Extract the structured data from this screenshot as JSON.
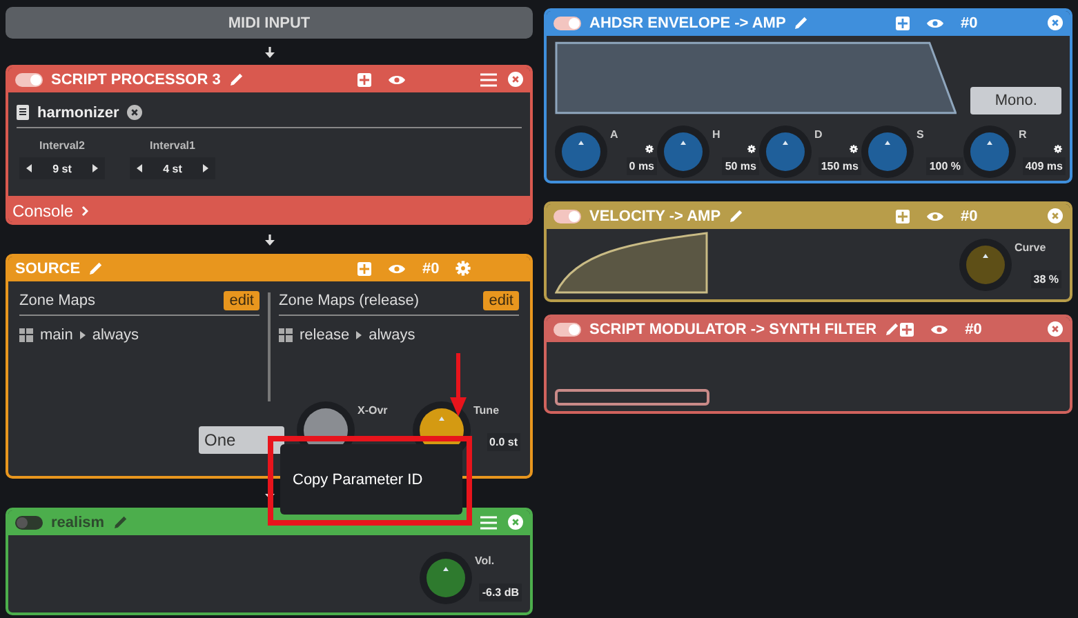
{
  "midi_input": {
    "label": "MIDI INPUT"
  },
  "left_modules": [
    {
      "kind": "script_processor",
      "title": "SCRIPT PROCESSOR 3",
      "color": "#d9594f",
      "enabled": true,
      "script": {
        "name": "harmonizer"
      },
      "params": [
        {
          "label": "Interval2",
          "value": "9 st"
        },
        {
          "label": "Interval1",
          "value": "4 st"
        }
      ],
      "footer": "Console"
    },
    {
      "kind": "source",
      "title": "SOURCE",
      "color": "#e8961e",
      "tag": "#0",
      "panels": [
        {
          "title": "Zone Maps",
          "edit": "edit",
          "zones": [
            {
              "name": "main",
              "condition": "always"
            }
          ]
        },
        {
          "title": "Zone Maps (release)",
          "edit": "edit",
          "zones": [
            {
              "name": "release",
              "condition": "always"
            }
          ]
        }
      ],
      "button": "One",
      "knobs": [
        {
          "label": "X-Ovr",
          "color": "#8a8d92"
        },
        {
          "label": "Tune",
          "value": "0.0 st",
          "color": "#d49a12"
        }
      ]
    },
    {
      "kind": "realism",
      "title": "realism",
      "color": "#4cae4c",
      "enabled": false,
      "knobs": [
        {
          "label": "Vol.",
          "value": "-6.3 dB",
          "color": "#2e7a2e"
        }
      ]
    }
  ],
  "right_modules": [
    {
      "kind": "envelope",
      "title": "AHDSR ENVELOPE -> AMP",
      "color": "#3f8fdc",
      "enabled": true,
      "tag": "#0",
      "button": "Mono.",
      "knobs": [
        {
          "label": "A",
          "value": "0 ms",
          "color": "#1f5f9a",
          "settings": true
        },
        {
          "label": "H",
          "value": "50 ms",
          "color": "#1f5f9a",
          "settings": true
        },
        {
          "label": "D",
          "value": "150 ms",
          "color": "#1f5f9a",
          "settings": true
        },
        {
          "label": "S",
          "value": "100 %",
          "color": "#1f5f9a",
          "settings": false
        },
        {
          "label": "R",
          "value": "409 ms",
          "color": "#1f5f9a",
          "settings": true
        }
      ]
    },
    {
      "kind": "velocity",
      "title": "VELOCITY -> AMP",
      "color": "#b89d4a",
      "enabled": true,
      "tag": "#0",
      "knobs": [
        {
          "label": "Curve",
          "value": "38 %",
          "color": "#5e4f17"
        }
      ]
    },
    {
      "kind": "modulator",
      "title": "SCRIPT MODULATOR -> SYNTH FILTER",
      "color": "#d0625d",
      "enabled": true,
      "tag": "#0"
    }
  ],
  "context_menu": {
    "items": [
      {
        "label": "Copy Parameter ID"
      }
    ]
  }
}
